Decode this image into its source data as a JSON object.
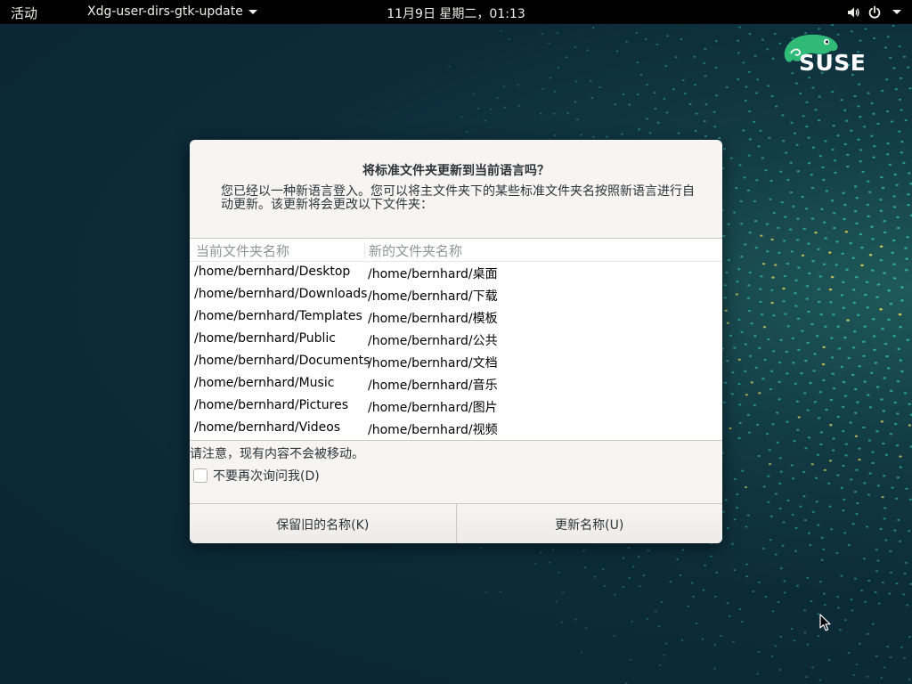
{
  "topbar": {
    "activities": "活动",
    "app_menu": "Xdg-user-dirs-gtk-update",
    "clock": "11月9日 星期二，01:13",
    "volume_icon": "speaker-icon",
    "power_icon": "power-icon"
  },
  "logo": {
    "text": "SUSE",
    "chameleon_color": "#30ba78"
  },
  "dialog": {
    "title": "将标准文件夹更新到当前语言吗？",
    "message": "您已经以一种新语言登入。您可以将主文件夹下的某些标准文件夹名按照新语言进行自动更新。该更新将会更改以下文件夹：",
    "table": {
      "headers": [
        "当前文件夹名称",
        "新的文件夹名称"
      ],
      "rows": [
        [
          "/home/bernhard/Desktop",
          "/home/bernhard/桌面"
        ],
        [
          "/home/bernhard/Downloads",
          "/home/bernhard/下载"
        ],
        [
          "/home/bernhard/Templates",
          "/home/bernhard/模板"
        ],
        [
          "/home/bernhard/Public",
          "/home/bernhard/公共"
        ],
        [
          "/home/bernhard/Documents",
          "/home/bernhard/文档"
        ],
        [
          "/home/bernhard/Music",
          "/home/bernhard/音乐"
        ],
        [
          "/home/bernhard/Pictures",
          "/home/bernhard/图片"
        ],
        [
          "/home/bernhard/Videos",
          "/home/bernhard/视频"
        ]
      ]
    },
    "note": "请注意，现有内容不会被移动。",
    "dont_ask_label": "不要再次询问我(D)",
    "dont_ask_checked": false,
    "keep_button": "保留旧的名称(K)",
    "update_button": "更新名称(U)"
  },
  "colors": {
    "topbar_bg": "#000000",
    "desktop_bg": "#0c2b39",
    "dialog_bg": "#f6f5f4",
    "dot_teal": "#2fb7a7",
    "dot_yellow": "#e6d85a"
  }
}
